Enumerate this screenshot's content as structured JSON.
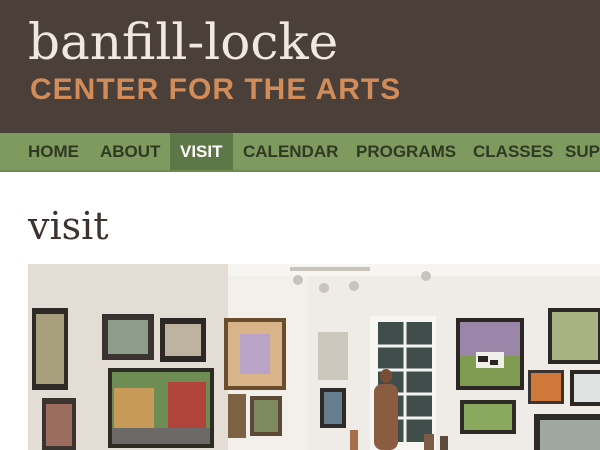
{
  "header": {
    "logo_line1": "banfill-locke",
    "logo_line2": "CENTER FOR THE ARTS"
  },
  "nav": {
    "items": [
      {
        "label": "HOME"
      },
      {
        "label": "ABOUT"
      },
      {
        "label": "VISIT"
      },
      {
        "label": "CALENDAR"
      },
      {
        "label": "PROGRAMS"
      },
      {
        "label": "CLASSES"
      },
      {
        "label": "SUP"
      }
    ],
    "active": "VISIT"
  },
  "main": {
    "title": "visit"
  },
  "colors": {
    "header_bg": "#4b3f3a",
    "logo_primary": "#efe9e2",
    "logo_accent": "#d28c5a",
    "nav_bg": "#7f9a5f",
    "nav_active_bg": "#5d7846"
  },
  "image": {
    "subject": "gallery-interior-photo"
  }
}
